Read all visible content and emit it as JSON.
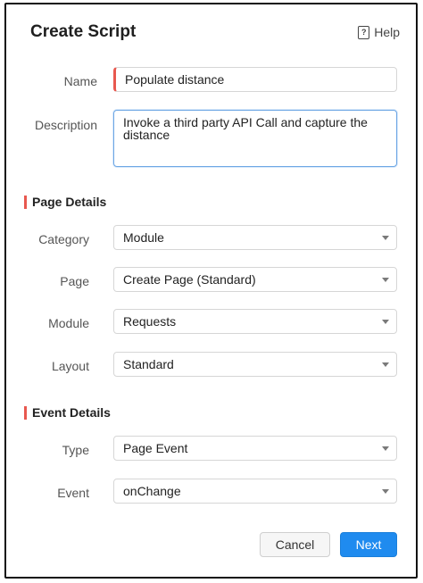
{
  "dialog": {
    "title": "Create Script",
    "help_label": "Help"
  },
  "fields": {
    "name": {
      "label": "Name",
      "value": "Populate distance"
    },
    "description": {
      "label": "Description",
      "value": "Invoke a third party API Call and capture the distance"
    }
  },
  "page_details": {
    "heading": "Page Details",
    "category": {
      "label": "Category",
      "value": "Module"
    },
    "page": {
      "label": "Page",
      "value": "Create Page (Standard)"
    },
    "module": {
      "label": "Module",
      "value": "Requests"
    },
    "layout": {
      "label": "Layout",
      "value": "Standard"
    }
  },
  "event_details": {
    "heading": "Event Details",
    "type": {
      "label": "Type",
      "value": "Page Event"
    },
    "event": {
      "label": "Event",
      "value": "onChange"
    }
  },
  "actions": {
    "cancel_label": "Cancel",
    "next_label": "Next"
  },
  "colors": {
    "accent": "#1f8bef",
    "required_marker": "#e8584f"
  }
}
